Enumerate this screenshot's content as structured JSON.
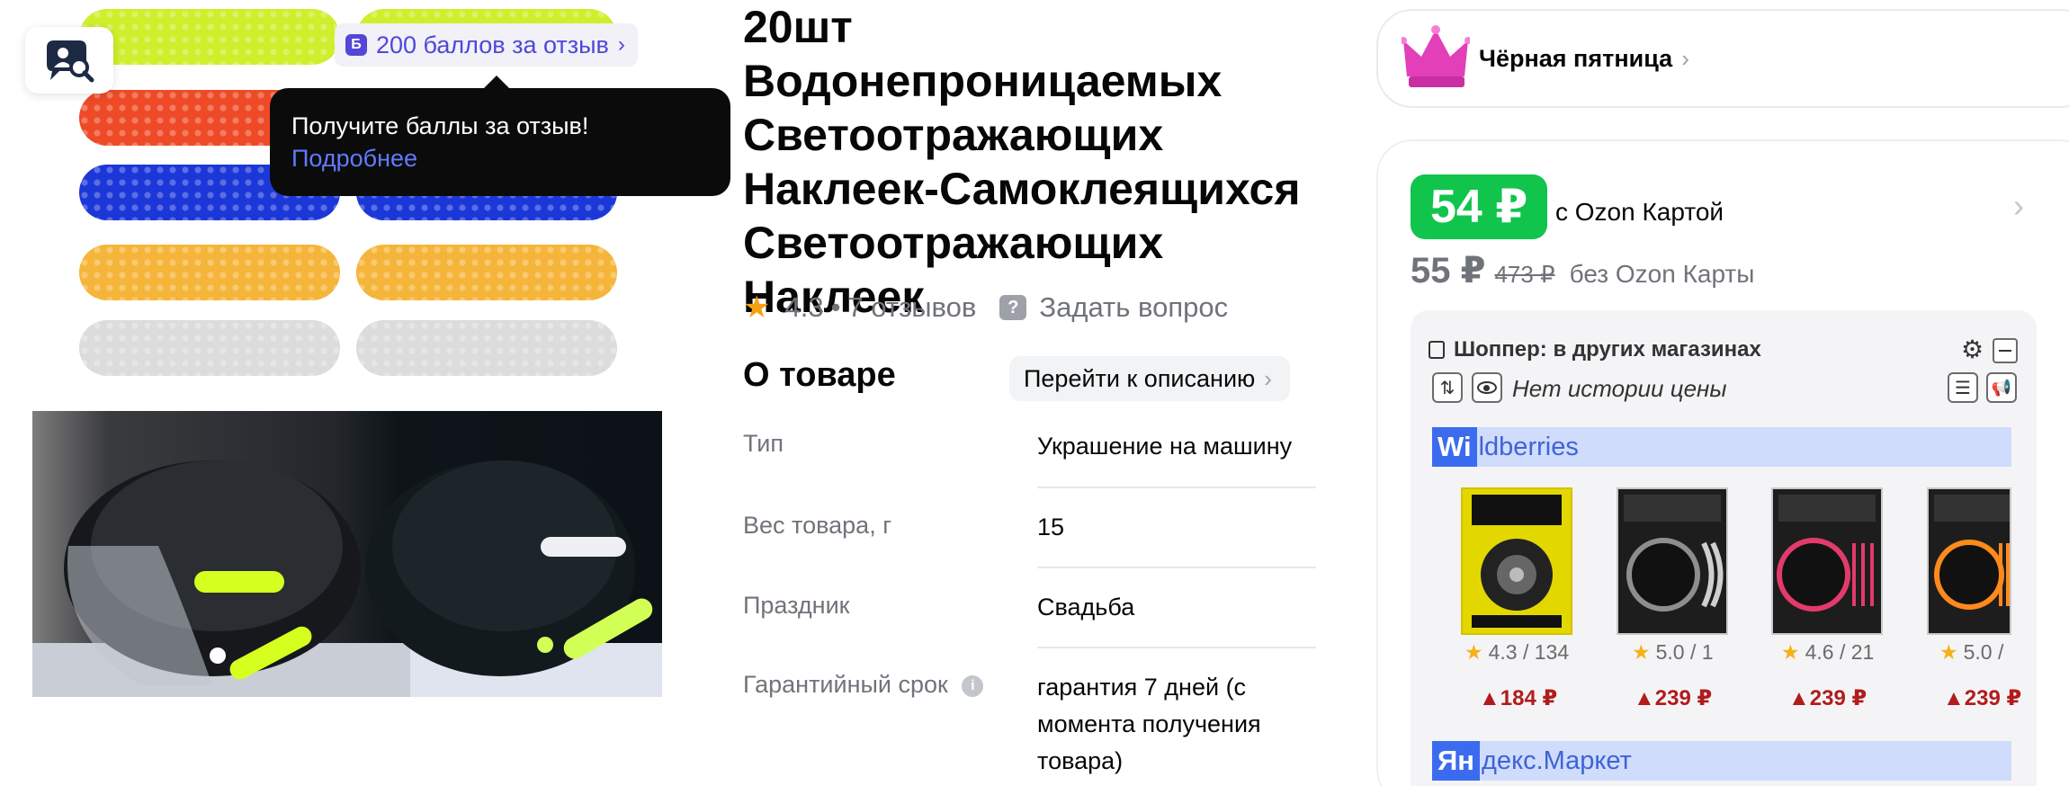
{
  "app_badge": {
    "icon": "shopper-extension-icon"
  },
  "review_badge": {
    "chip": "Б",
    "label": "200 баллов за отзыв"
  },
  "tooltip": {
    "text": "Получите баллы за отзыв!",
    "link": "Подробнее"
  },
  "gallery": {
    "strip_colors": [
      "#cfee2c",
      "#ee4a27",
      "#1c37d8",
      "#f5b53a",
      "#dcdcdc"
    ]
  },
  "product": {
    "title": "20шт Водонепроницаемых Светоотражающих Наклеек-Самоклеящихся Светоотражающих Наклеек",
    "rating": "4.3",
    "separator": "•",
    "reviews": "7 отзывов",
    "ask_question": "Задать вопрос"
  },
  "about": {
    "title": "О товаре",
    "link": "Перейти к описанию",
    "specs": [
      {
        "label": "Тип",
        "value": "Украшение на машину"
      },
      {
        "label": "Вес товара, г",
        "value": "15"
      },
      {
        "label": "Праздник",
        "value": "Свадьба"
      },
      {
        "label": "Гарантийный срок",
        "value": "гарантия 7 дней (с момента получения товара)"
      }
    ]
  },
  "promo": {
    "label": "Чёрная пятница"
  },
  "price": {
    "card_price": "54 ₽",
    "card_label": "с Ozon Картой",
    "regular_price": "55 ₽",
    "old_price": "473 ₽",
    "regular_label": "без Ozon Карты"
  },
  "shopper": {
    "title": "Шоппер: в других магазинах",
    "history": "Нет истории цены",
    "stores": [
      {
        "highlight": "Wi",
        "rest": "ldberries",
        "products": [
          {
            "rating": "4.3 / 134",
            "price": "▲184 ₽"
          },
          {
            "rating": "5.0 / 1",
            "price": "▲239 ₽"
          },
          {
            "rating": "4.6 / 21",
            "price": "▲239 ₽"
          },
          {
            "rating": "5.0 /",
            "price": "▲239 ₽"
          }
        ]
      },
      {
        "highlight": "Ян",
        "rest": "декс.Маркет"
      }
    ]
  }
}
